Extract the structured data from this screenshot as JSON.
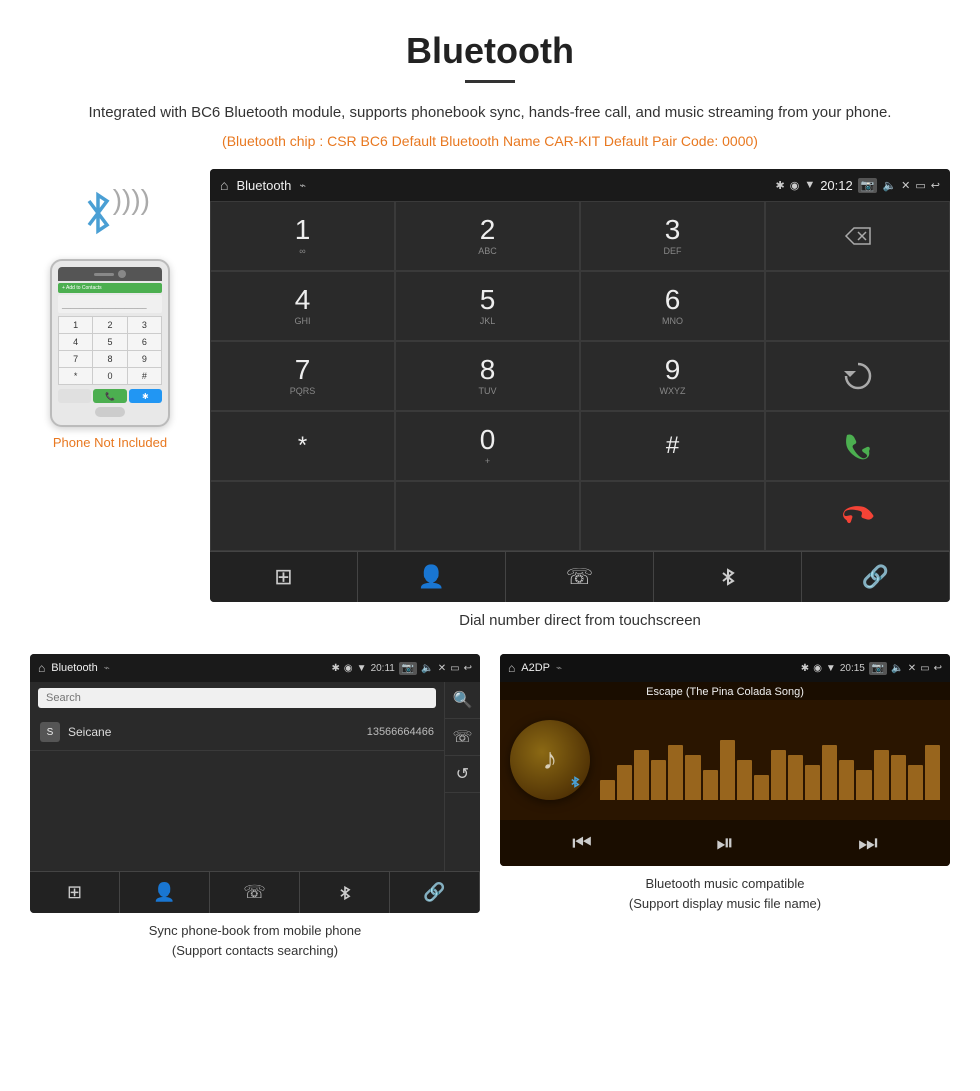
{
  "page": {
    "title": "Bluetooth",
    "title_underline": true,
    "description": "Integrated with BC6 Bluetooth module, supports phonebook sync, hands-free call, and music streaming from your phone.",
    "specs": "(Bluetooth chip : CSR BC6    Default Bluetooth Name CAR-KIT    Default Pair Code: 0000)"
  },
  "phone_section": {
    "not_included_label": "Phone Not Included"
  },
  "dialer_screen": {
    "status_bar": {
      "title": "Bluetooth",
      "usb_icon": "⌁",
      "time": "20:12",
      "icons": [
        "✱",
        "◉",
        "▼"
      ]
    },
    "keys": [
      {
        "num": "1",
        "letters": "∞"
      },
      {
        "num": "2",
        "letters": "ABC"
      },
      {
        "num": "3",
        "letters": "DEF"
      },
      {
        "num": "",
        "letters": ""
      },
      {
        "num": "4",
        "letters": "GHI"
      },
      {
        "num": "5",
        "letters": "JKL"
      },
      {
        "num": "6",
        "letters": "MNO"
      },
      {
        "num": "",
        "letters": ""
      },
      {
        "num": "7",
        "letters": "PQRS"
      },
      {
        "num": "8",
        "letters": "TUV"
      },
      {
        "num": "9",
        "letters": "WXYZ"
      },
      {
        "num": "",
        "letters": ""
      },
      {
        "num": "*",
        "letters": ""
      },
      {
        "num": "0",
        "letters": "+"
      },
      {
        "num": "#",
        "letters": ""
      }
    ],
    "nav_items": [
      "⊞",
      "👤",
      "☏",
      "✱",
      "🔗"
    ]
  },
  "dial_label": "Dial number direct from touchscreen",
  "phonebook_screen": {
    "status_bar": {
      "title": "Bluetooth",
      "time": "20:11"
    },
    "search_placeholder": "Search",
    "contacts": [
      {
        "letter": "S",
        "name": "Seicane",
        "number": "13566664466"
      }
    ],
    "nav_items": [
      "⊞",
      "👤",
      "☏",
      "✱",
      "🔗"
    ]
  },
  "phonebook_caption": "Sync phone-book from mobile phone\n(Support contacts searching)",
  "music_screen": {
    "status_bar": {
      "title": "A2DP",
      "time": "20:15"
    },
    "song_title": "Escape (The Pina Colada Song)",
    "bar_heights": [
      20,
      35,
      50,
      40,
      55,
      45,
      30,
      60,
      40,
      25,
      50,
      45,
      35,
      55,
      40,
      30,
      50,
      45,
      35,
      55
    ],
    "controls": [
      "⏮",
      "⏯",
      "⏭"
    ]
  },
  "music_caption": "Bluetooth music compatible\n(Support display music file name)"
}
